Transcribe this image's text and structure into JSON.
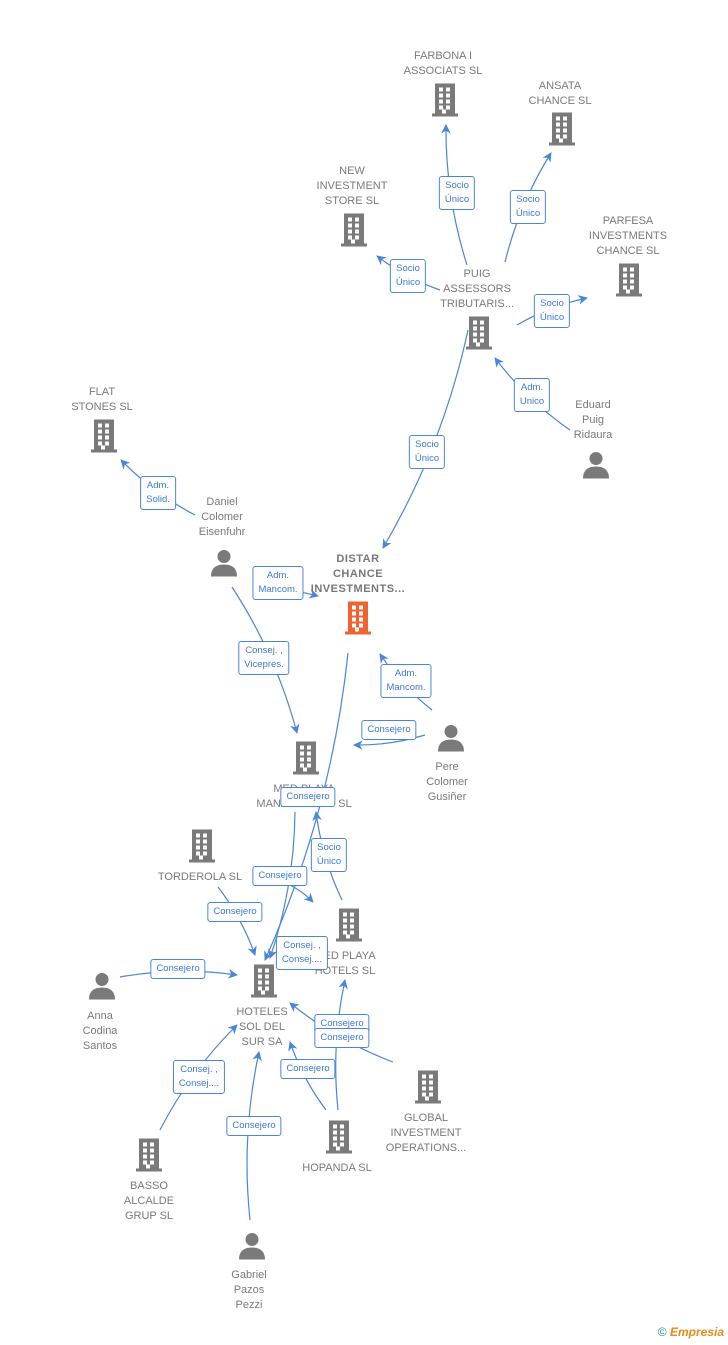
{
  "colors": {
    "node": "#7a7a7a",
    "main_node": "#f26130",
    "edge": "#4a86d8"
  },
  "nodes": [
    {
      "id": "farbona",
      "type": "company",
      "label": "FARBONA I\nASSOCIATS  SL"
    },
    {
      "id": "ansata",
      "type": "company",
      "label": "ANSATA\nCHANCE  SL"
    },
    {
      "id": "newinv",
      "type": "company",
      "label": "NEW\nINVESTMENT\nSTORE  SL"
    },
    {
      "id": "parfesa",
      "type": "company",
      "label": "PARFESA\nINVESTMENTS\nCHANCE  SL"
    },
    {
      "id": "puig",
      "type": "company",
      "label": "PUIG\nASSESSORS\nTRIBUTARIS..."
    },
    {
      "id": "eduard",
      "type": "person",
      "label": "Eduard\nPuig\nRidaura"
    },
    {
      "id": "flat",
      "type": "company",
      "label": "FLAT\nSTONES SL"
    },
    {
      "id": "daniel",
      "type": "person",
      "label": "Daniel\nColomer\nEisenfuhr"
    },
    {
      "id": "distar",
      "type": "main",
      "label": "DISTAR\nCHANCE\nINVESTMENTS..."
    },
    {
      "id": "medmgmt",
      "type": "company",
      "label": "MED PLAYA\nMANAGEMENT SL"
    },
    {
      "id": "pere",
      "type": "person",
      "label": "Pere\nColomer\nGusiñer"
    },
    {
      "id": "torderola",
      "type": "company",
      "label": "TORDEROLA SL"
    },
    {
      "id": "medhotels",
      "type": "company",
      "label": "MED PLAYA\nHOTELS  SL"
    },
    {
      "id": "hoteles",
      "type": "company",
      "label": "HOTELES\nSOL DEL\nSUR SA"
    },
    {
      "id": "anna",
      "type": "person",
      "label": "Anna\nCodina\nSantos"
    },
    {
      "id": "global",
      "type": "company",
      "label": "GLOBAL\nINVESTMENT\nOPERATIONS..."
    },
    {
      "id": "hopanda",
      "type": "company",
      "label": "HOPANDA SL"
    },
    {
      "id": "basso",
      "type": "company",
      "label": "BASSO\nALCALDE\nGRUP  SL"
    },
    {
      "id": "gabriel",
      "type": "person",
      "label": "Gabriel\nPazos\nPezzi"
    }
  ],
  "edges": [
    {
      "from": "puig",
      "to": "farbona",
      "label": "Socio\nÚnico"
    },
    {
      "from": "puig",
      "to": "ansata",
      "label": "Socio\nÚnico"
    },
    {
      "from": "puig",
      "to": "newinv",
      "label": "Socio\nÚnico"
    },
    {
      "from": "puig",
      "to": "parfesa",
      "label": "Socio\nÚnico"
    },
    {
      "from": "eduard",
      "to": "puig",
      "label": "Adm.\nUnico"
    },
    {
      "from": "puig",
      "to": "distar",
      "label": "Socio\nÚnico"
    },
    {
      "from": "daniel",
      "to": "flat",
      "label": "Adm.\nSolid."
    },
    {
      "from": "daniel",
      "to": "distar",
      "label": "Adm.\nMancom."
    },
    {
      "from": "daniel",
      "to": "medmgmt",
      "label": "Consej. ,\nVicepres."
    },
    {
      "from": "pere",
      "to": "distar",
      "label": "Adm.\nMancom."
    },
    {
      "from": "pere",
      "to": "medmgmt",
      "label": "Consejero"
    },
    {
      "from": "distar",
      "to": "hoteles",
      "label": "Consej. ,\nConsej...."
    },
    {
      "from": "medmgmt",
      "to": "hoteles",
      "label": "Consejero"
    },
    {
      "from": "medhotels",
      "to": "medmgmt",
      "label": "Socio\nÚnico"
    },
    {
      "from": "torderola",
      "to": "medhotels",
      "label": "Consejero"
    },
    {
      "from": "torderola",
      "to": "hoteles",
      "label": "Consejero"
    },
    {
      "from": "anna",
      "to": "hoteles",
      "label": "Consejero"
    },
    {
      "from": "global",
      "to": "hoteles",
      "label": "Consejero"
    },
    {
      "from": "hopanda",
      "to": "medhotels",
      "label": "Consejero"
    },
    {
      "from": "hopanda",
      "to": "hoteles",
      "label": "Consejero"
    },
    {
      "from": "basso",
      "to": "hoteles",
      "label": "Consej. ,\nConsej...."
    },
    {
      "from": "gabriel",
      "to": "hoteles",
      "label": "Consejero"
    }
  ],
  "footer": {
    "copyright": "©",
    "brand": "Empresia"
  }
}
